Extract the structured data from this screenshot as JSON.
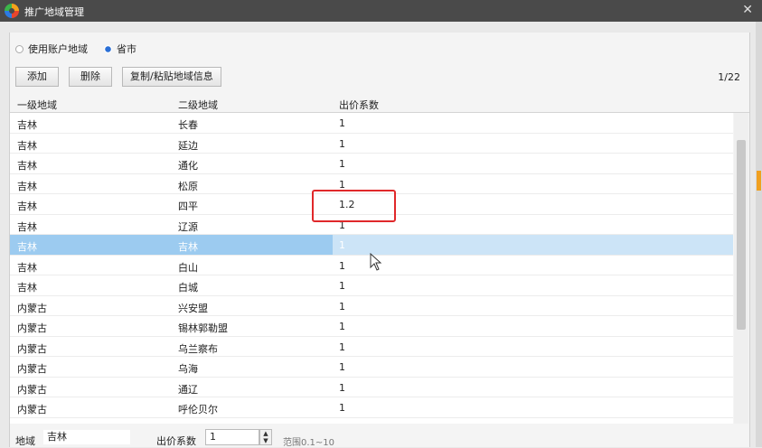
{
  "window": {
    "title": "推广地域管理"
  },
  "mode": {
    "options": [
      "使用账户地域",
      "省市"
    ],
    "selected_index": 1
  },
  "toolbar": {
    "add_label": "添加",
    "delete_label": "删除",
    "copy_label": "复制/粘贴地域信息"
  },
  "pager": {
    "text": "1/22"
  },
  "table": {
    "headers": [
      "一级地域",
      "二级地域",
      "出价系数"
    ],
    "rows": [
      [
        "吉林",
        "长春",
        "1"
      ],
      [
        "吉林",
        "延边",
        "1"
      ],
      [
        "吉林",
        "通化",
        "1"
      ],
      [
        "吉林",
        "松原",
        "1"
      ],
      [
        "吉林",
        "四平",
        "1.2"
      ],
      [
        "吉林",
        "辽源",
        "1"
      ],
      [
        "吉林",
        "吉林",
        "1"
      ],
      [
        "吉林",
        "白山",
        "1"
      ],
      [
        "吉林",
        "白城",
        "1"
      ],
      [
        "内蒙古",
        "兴安盟",
        "1"
      ],
      [
        "内蒙古",
        "锡林郭勒盟",
        "1"
      ],
      [
        "内蒙古",
        "乌兰察布",
        "1"
      ],
      [
        "内蒙古",
        "乌海",
        "1"
      ],
      [
        "内蒙古",
        "通辽",
        "1"
      ],
      [
        "内蒙古",
        "呼伦贝尔",
        "1"
      ]
    ],
    "selected_row_index": 6
  },
  "footer": {
    "region_label": "地域",
    "region_value": "吉林",
    "coef_label": "出价系数",
    "coef_value": "1",
    "range_text": "范围0.1~10"
  },
  "colors": {
    "selection": "#cce4f7",
    "highlight_box": "#e0282a",
    "radio_accent": "#2a6fd6"
  }
}
